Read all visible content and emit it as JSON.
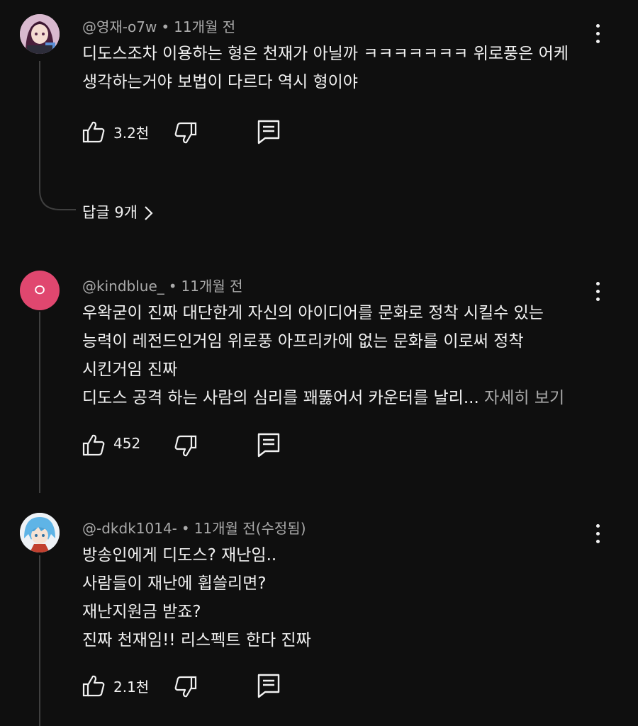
{
  "comments": [
    {
      "author": "@영재-o7w",
      "separator": "•",
      "time": "11개월 전",
      "edited": "",
      "lines": [
        "디도스조차 이용하는 형은 천재가 아닐까 ㅋㅋㅋㅋㅋㅋㅋ 위로풍은 어케",
        "생각하는거야 보법이 다르다 역시 형이야"
      ],
      "more": "",
      "likes": "3.2천",
      "avatar": "anime-girl-avatar",
      "replies_label": "답글 9개"
    },
    {
      "author": "@kindblue_",
      "separator": "•",
      "time": "11개월 전",
      "edited": "",
      "lines": [
        "우왁굳이 진짜 대단한게 자신의 아이디어를 문화로 정착 시킬수 있는",
        "능력이 레전드인거임 위로풍 아프리카에 없는 문화를 이로써 정착",
        "시킨거임 진짜",
        "디도스 공격 하는 사람의 심리를 꽤뚫어서 카운터를 날리... "
      ],
      "more": "자세히 보기",
      "likes": "452",
      "avatar_letter": "ㅇ",
      "avatar_color": "#e0476f"
    },
    {
      "author": "@-dkdk1014-",
      "separator": "•",
      "time": "11개월 전",
      "edited": "(수정됨)",
      "lines": [
        "방송인에게 디도스? 재난임..",
        "사람들이 재난에 휩쓸리면?",
        "재난지원금 받죠?",
        "진짜 천재임!! 리스펙트 한다 진짜"
      ],
      "more": "",
      "likes": "2.1천",
      "avatar": "blue-hair-avatar"
    }
  ],
  "colors": {
    "background": "#0f0f0f",
    "text": "#f1f1f1",
    "secondary": "#aaaaaa"
  }
}
